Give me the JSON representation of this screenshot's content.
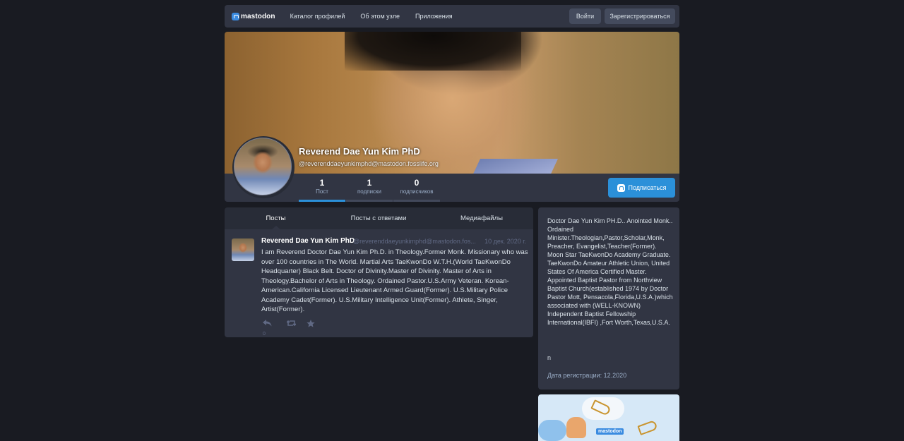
{
  "topbar": {
    "logo_text": "mastodon",
    "nav": [
      "Каталог профилей",
      "Об этом узле",
      "Приложения"
    ],
    "login_label": "Войти",
    "register_label": "Зарегистрироваться"
  },
  "profile": {
    "display_name": "Reverend Dae Yun Kim PhD",
    "handle": "@reverenddaeyunkimphd@mastodon.fosslife.org",
    "counters": [
      {
        "num": "1",
        "label": "Пост"
      },
      {
        "num": "1",
        "label": "подписки"
      },
      {
        "num": "0",
        "label": "подписчиков"
      }
    ],
    "follow_label": "Подписаться"
  },
  "tabs": [
    "Посты",
    "Посты с ответами",
    "Медиафайлы"
  ],
  "status": {
    "name": "Reverend Dae Yun Kim PhD",
    "handle": "@reverenddaeyunkimphd@mastodon.fos...",
    "time": "10 дек. 2020 г.",
    "text": "I am Reverend Doctor Dae Yun Kim Ph.D. in Theology.Former Monk. Missionary who was over 100 countries in The World. Martial Arts TaeKwonDo W.T.H.(World TaeKwonDo Headquarter) Black Belt. Doctor of Divinity.Master of Divinity. Master of Arts in Theology.Bachelor of Arts in Theology. Ordained Pastor.U.S.Army Veteran. Korean-American.California Licensed Lieutenant Armed Guard(Former). U.S.Military Police Academy Cadet(Former). U.S.Military Intelligence Unit(Former). Athlete, Singer, Artist(Former).",
    "reply_count": "0"
  },
  "bio": {
    "text": "Doctor Dae Yun Kim PH.D.. Anointed Monk.. Ordained Minister.Theologian,Pastor,Scholar,Monk, Preacher, Evangelist,Teacher(Former). Moon Star TaeKwonDo Academy Graduate. TaeKwonDo Amateur Athletic Union, United States Of America Certified Master. Appointed Baptist Pastor from Northview Baptist Church(established 1974 by Doctor Pastor Mott, Pensacola,Florida,U.S.A.)which associated with (WELL-KNOWN) Independent Baptist Fellowship International(IBFI) ,Fort Worth,Texas,U.S.A.",
    "extra": "n",
    "joined": "Дата регистрации: 12.2020"
  },
  "promo": {
    "logo_text": "mastodon"
  },
  "colors": {
    "accent": "#2b90d9",
    "bg": "#191b22",
    "panel": "#313543"
  }
}
